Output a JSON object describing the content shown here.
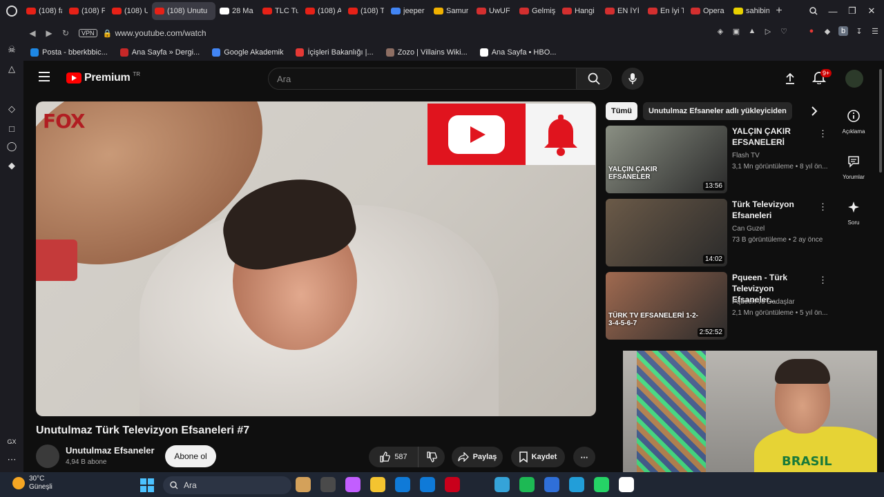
{
  "browser": {
    "tabs": [
      {
        "label": "(108) fa",
        "color": "#e62117"
      },
      {
        "label": "(108) F",
        "color": "#e62117"
      },
      {
        "label": "(108) U",
        "color": "#e62117"
      },
      {
        "label": "(108) Unutu",
        "color": "#e62117",
        "active": true
      },
      {
        "label": "28 Ma",
        "color": "#ffffff"
      },
      {
        "label": "TLC Tu",
        "color": "#e62117"
      },
      {
        "label": "(108) A",
        "color": "#e62117"
      },
      {
        "label": "(108) T",
        "color": "#e62117"
      },
      {
        "label": "jeeper",
        "color": "#4285f4"
      },
      {
        "label": "Samur",
        "color": "#f0b100"
      },
      {
        "label": "UwUF",
        "color": "#d32f2f"
      },
      {
        "label": "Gelmiş",
        "color": "#d32f2f"
      },
      {
        "label": "Hangi",
        "color": "#d32f2f"
      },
      {
        "label": "EN İYİ",
        "color": "#d32f2f"
      },
      {
        "label": "En İyi T",
        "color": "#d32f2f"
      },
      {
        "label": "Opera",
        "color": "#d32f2f"
      },
      {
        "label": "sahibin",
        "color": "#e8d100"
      }
    ],
    "vpn_label": "VPN",
    "url": "www.youtube.com/watch",
    "bookmarks": [
      {
        "label": "Posta - bberkbbic...",
        "color": "#1e88e5"
      },
      {
        "label": "Ana Sayfa » Dergi...",
        "color": "#c62828"
      },
      {
        "label": "Google Akademik",
        "color": "#4285f4"
      },
      {
        "label": "İçişleri Bakanlığı |...",
        "color": "#e53935"
      },
      {
        "label": "Zozo | Villains Wiki...",
        "color": "#8d6e63"
      },
      {
        "label": "Ana Sayfa • HBO...",
        "color": "#ffffff"
      }
    ],
    "sidebar_bottom_label": "GX"
  },
  "youtube": {
    "logo_word": "Premium",
    "logo_country": "TR",
    "search_placeholder": "Ara",
    "notification_count": "9+",
    "video": {
      "watermark": "FOX",
      "title": "Unutulmaz Türk Televizyon Efsaneleri #7",
      "channel": "Unutulmaz Efsaneler",
      "subscribers": "4,94 B abone",
      "subscribe_label": "Abone ol",
      "likes": "587",
      "share_label": "Paylaş",
      "save_label": "Kaydet"
    },
    "chips": [
      "Tümü",
      "Unutulmaz Efsaneler adlı yükleyiciden"
    ],
    "recommendations": [
      {
        "title": "YALÇIN ÇAKIR EFSANELERİ",
        "channel": "Flash TV",
        "meta": "3,1 Mn görüntüleme • 8 yıl ön...",
        "duration": "13:56",
        "thumb_caption": "YALÇIN ÇAKIR EFSANELER",
        "thumb_color": "#8a8f83"
      },
      {
        "title": "Türk Televizyon Efsaneleri",
        "channel": "Can Guzel",
        "meta": "73 B görüntüleme • 2 ay önce",
        "duration": "14:02",
        "thumb_caption": "",
        "thumb_color": "#6b5a48"
      },
      {
        "title": "Pqueen - Türk Televizyon Efsaneler...",
        "channel": "Pqueen ve Dadaşlar",
        "meta": "2,1 Mn görüntüleme • 5 yıl ön...",
        "duration": "2:52:52",
        "thumb_caption": "TÜRK TV EFSANELERİ 1-2-3-4-5-6-7",
        "thumb_color": "#a06a50"
      }
    ],
    "rail": [
      {
        "label": "Açıklama",
        "icon": "info-icon"
      },
      {
        "label": "Yorumlar",
        "icon": "comments-icon"
      },
      {
        "label": "Soru",
        "icon": "sparkle-icon"
      }
    ],
    "webcam_shirt_text": "BRASIL"
  },
  "taskbar": {
    "temperature": "30°C",
    "weather": "Güneşli",
    "search_placeholder": "Ara",
    "app_colors": [
      "#d4a15a",
      "#4a4a4a",
      "#c25eff",
      "#f4c430",
      "#0f7ad8",
      "#0f7ad8",
      "#c9001b",
      "#1f2633",
      "#35a3d9",
      "#1db954",
      "#2f6fd8",
      "#229ed9",
      "#25d366",
      "#ffffff"
    ]
  }
}
